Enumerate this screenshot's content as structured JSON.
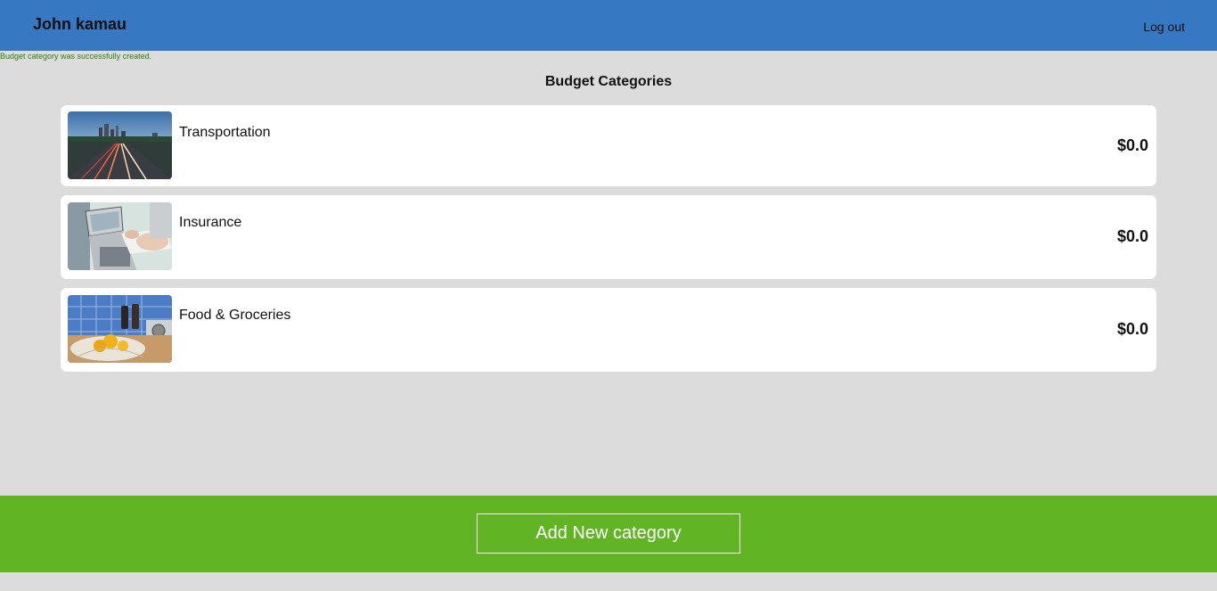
{
  "header": {
    "user_name": "John kamau",
    "logout_label": "Log out",
    "color": "#3778c2"
  },
  "notice": {
    "text": "Budget category was successfully created.",
    "color": "#2e7d14"
  },
  "page": {
    "title": "Budget Categories"
  },
  "categories": [
    {
      "name": "Transportation",
      "amount": "$0.0",
      "image": "city-highway-photo"
    },
    {
      "name": "Insurance",
      "amount": "$0.0",
      "image": "laptop-paperwork-photo"
    },
    {
      "name": "Food & Groceries",
      "amount": "$0.0",
      "image": "lemons-kitchen-photo"
    }
  ],
  "footer": {
    "add_button_label": "Add New category",
    "color": "#61b524"
  }
}
